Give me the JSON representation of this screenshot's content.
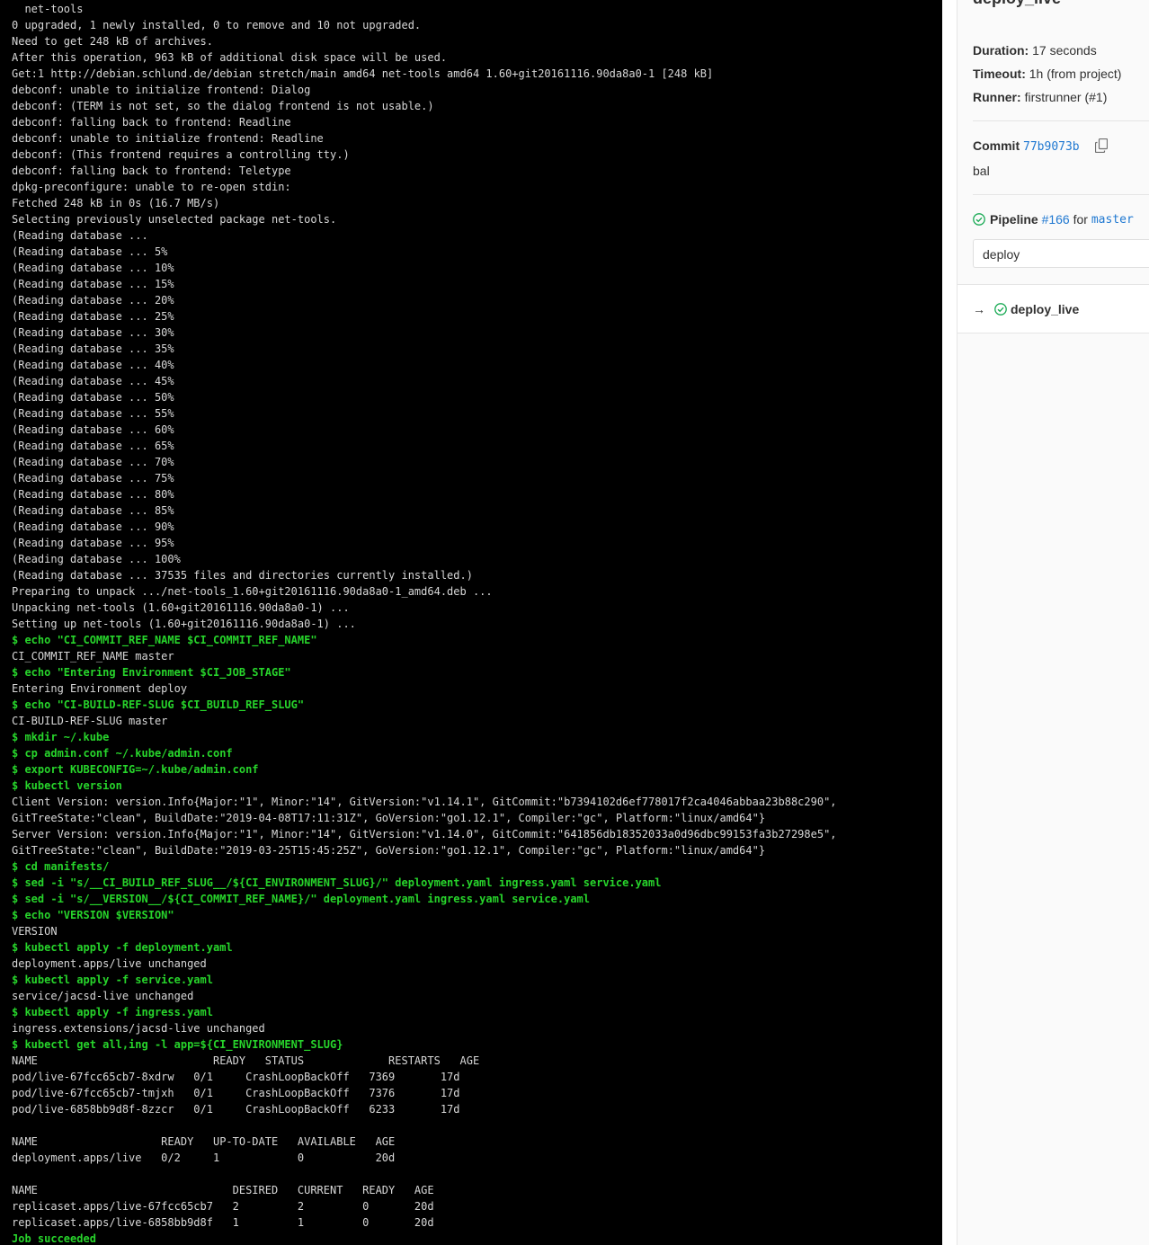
{
  "log": {
    "lines": [
      {
        "t": "  net-tools",
        "k": "out"
      },
      {
        "t": "0 upgraded, 1 newly installed, 0 to remove and 10 not upgraded.",
        "k": "out"
      },
      {
        "t": "Need to get 248 kB of archives.",
        "k": "out"
      },
      {
        "t": "After this operation, 963 kB of additional disk space will be used.",
        "k": "out"
      },
      {
        "t": "Get:1 http://debian.schlund.de/debian stretch/main amd64 net-tools amd64 1.60+git20161116.90da8a0-1 [248 kB]",
        "k": "out"
      },
      {
        "t": "debconf: unable to initialize frontend: Dialog",
        "k": "out"
      },
      {
        "t": "debconf: (TERM is not set, so the dialog frontend is not usable.)",
        "k": "out"
      },
      {
        "t": "debconf: falling back to frontend: Readline",
        "k": "out"
      },
      {
        "t": "debconf: unable to initialize frontend: Readline",
        "k": "out"
      },
      {
        "t": "debconf: (This frontend requires a controlling tty.)",
        "k": "out"
      },
      {
        "t": "debconf: falling back to frontend: Teletype",
        "k": "out"
      },
      {
        "t": "dpkg-preconfigure: unable to re-open stdin:",
        "k": "out"
      },
      {
        "t": "Fetched 248 kB in 0s (16.7 MB/s)",
        "k": "out"
      },
      {
        "t": "Selecting previously unselected package net-tools.",
        "k": "out"
      },
      {
        "t": "(Reading database ...",
        "k": "out"
      },
      {
        "t": "(Reading database ... 5%",
        "k": "out"
      },
      {
        "t": "(Reading database ... 10%",
        "k": "out"
      },
      {
        "t": "(Reading database ... 15%",
        "k": "out"
      },
      {
        "t": "(Reading database ... 20%",
        "k": "out"
      },
      {
        "t": "(Reading database ... 25%",
        "k": "out"
      },
      {
        "t": "(Reading database ... 30%",
        "k": "out"
      },
      {
        "t": "(Reading database ... 35%",
        "k": "out"
      },
      {
        "t": "(Reading database ... 40%",
        "k": "out"
      },
      {
        "t": "(Reading database ... 45%",
        "k": "out"
      },
      {
        "t": "(Reading database ... 50%",
        "k": "out"
      },
      {
        "t": "(Reading database ... 55%",
        "k": "out"
      },
      {
        "t": "(Reading database ... 60%",
        "k": "out"
      },
      {
        "t": "(Reading database ... 65%",
        "k": "out"
      },
      {
        "t": "(Reading database ... 70%",
        "k": "out"
      },
      {
        "t": "(Reading database ... 75%",
        "k": "out"
      },
      {
        "t": "(Reading database ... 80%",
        "k": "out"
      },
      {
        "t": "(Reading database ... 85%",
        "k": "out"
      },
      {
        "t": "(Reading database ... 90%",
        "k": "out"
      },
      {
        "t": "(Reading database ... 95%",
        "k": "out"
      },
      {
        "t": "(Reading database ... 100%",
        "k": "out"
      },
      {
        "t": "(Reading database ... 37535 files and directories currently installed.)",
        "k": "out"
      },
      {
        "t": "Preparing to unpack .../net-tools_1.60+git20161116.90da8a0-1_amd64.deb ...",
        "k": "out"
      },
      {
        "t": "Unpacking net-tools (1.60+git20161116.90da8a0-1) ...",
        "k": "out"
      },
      {
        "t": "Setting up net-tools (1.60+git20161116.90da8a0-1) ...",
        "k": "out"
      },
      {
        "t": "$ echo \"CI_COMMIT_REF_NAME $CI_COMMIT_REF_NAME\"",
        "k": "cmd"
      },
      {
        "t": "CI_COMMIT_REF_NAME master",
        "k": "out"
      },
      {
        "t": "$ echo \"Entering Environment $CI_JOB_STAGE\"",
        "k": "cmd"
      },
      {
        "t": "Entering Environment deploy",
        "k": "out"
      },
      {
        "t": "$ echo \"CI-BUILD-REF-SLUG $CI_BUILD_REF_SLUG\"",
        "k": "cmd"
      },
      {
        "t": "CI-BUILD-REF-SLUG master",
        "k": "out"
      },
      {
        "t": "$ mkdir ~/.kube",
        "k": "cmd"
      },
      {
        "t": "$ cp admin.conf ~/.kube/admin.conf",
        "k": "cmd"
      },
      {
        "t": "$ export KUBECONFIG=~/.kube/admin.conf",
        "k": "cmd"
      },
      {
        "t": "$ kubectl version",
        "k": "cmd"
      },
      {
        "t": "Client Version: version.Info{Major:\"1\", Minor:\"14\", GitVersion:\"v1.14.1\", GitCommit:\"b7394102d6ef778017f2ca4046abbaa23b88c290\",",
        "k": "out"
      },
      {
        "t": "GitTreeState:\"clean\", BuildDate:\"2019-04-08T17:11:31Z\", GoVersion:\"go1.12.1\", Compiler:\"gc\", Platform:\"linux/amd64\"}",
        "k": "out"
      },
      {
        "t": "Server Version: version.Info{Major:\"1\", Minor:\"14\", GitVersion:\"v1.14.0\", GitCommit:\"641856db18352033a0d96dbc99153fa3b27298e5\",",
        "k": "out"
      },
      {
        "t": "GitTreeState:\"clean\", BuildDate:\"2019-03-25T15:45:25Z\", GoVersion:\"go1.12.1\", Compiler:\"gc\", Platform:\"linux/amd64\"}",
        "k": "out"
      },
      {
        "t": "$ cd manifests/",
        "k": "cmd"
      },
      {
        "t": "$ sed -i \"s/__CI_BUILD_REF_SLUG__/${CI_ENVIRONMENT_SLUG}/\" deployment.yaml ingress.yaml service.yaml",
        "k": "cmd"
      },
      {
        "t": "$ sed -i \"s/__VERSION__/${CI_COMMIT_REF_NAME}/\" deployment.yaml ingress.yaml service.yaml",
        "k": "cmd"
      },
      {
        "t": "$ echo \"VERSION $VERSION\"",
        "k": "cmd"
      },
      {
        "t": "VERSION",
        "k": "out"
      },
      {
        "t": "$ kubectl apply -f deployment.yaml",
        "k": "cmd"
      },
      {
        "t": "deployment.apps/live unchanged",
        "k": "out"
      },
      {
        "t": "$ kubectl apply -f service.yaml",
        "k": "cmd"
      },
      {
        "t": "service/jacsd-live unchanged",
        "k": "out"
      },
      {
        "t": "$ kubectl apply -f ingress.yaml",
        "k": "cmd"
      },
      {
        "t": "ingress.extensions/jacsd-live unchanged",
        "k": "out"
      },
      {
        "t": "$ kubectl get all,ing -l app=${CI_ENVIRONMENT_SLUG}",
        "k": "cmd"
      },
      {
        "t": "NAME                           READY   STATUS             RESTARTS   AGE",
        "k": "out"
      },
      {
        "t": "pod/live-67fcc65cb7-8xdrw   0/1     CrashLoopBackOff   7369       17d",
        "k": "out"
      },
      {
        "t": "pod/live-67fcc65cb7-tmjxh   0/1     CrashLoopBackOff   7376       17d",
        "k": "out"
      },
      {
        "t": "pod/live-6858bb9d8f-8zzcr   0/1     CrashLoopBackOff   6233       17d",
        "k": "out"
      },
      {
        "t": "",
        "k": "out"
      },
      {
        "t": "NAME                   READY   UP-TO-DATE   AVAILABLE   AGE",
        "k": "out"
      },
      {
        "t": "deployment.apps/live   0/2     1            0           20d",
        "k": "out"
      },
      {
        "t": "",
        "k": "out"
      },
      {
        "t": "NAME                              DESIRED   CURRENT   READY   AGE",
        "k": "out"
      },
      {
        "t": "replicaset.apps/live-67fcc65cb7   2         2         0       20d",
        "k": "out"
      },
      {
        "t": "replicaset.apps/live-6858bb9d8f   1         1         0       20d",
        "k": "out"
      },
      {
        "t": "Job succeeded",
        "k": "ok"
      }
    ]
  },
  "sidebar": {
    "title": "deploy_live",
    "duration_label": "Duration:",
    "duration_value": "17 seconds",
    "timeout_label": "Timeout:",
    "timeout_value": "1h (from project)",
    "runner_label": "Runner:",
    "runner_value": "firstrunner (#1)",
    "commit_label": "Commit",
    "commit_sha": "77b9073b",
    "commit_message": "bal",
    "pipeline_label": "Pipeline",
    "pipeline_id": "#166",
    "pipeline_for": "for",
    "pipeline_ref": "master",
    "stage_selected": "deploy",
    "job_arrow": "→",
    "job_name": "deploy_live"
  },
  "colors": {
    "terminal_bg": "#000000",
    "terminal_text": "#d8d8d8",
    "command_green": "#27d42b",
    "link_blue": "#1f78d1",
    "success_green": "#1aaa55"
  }
}
